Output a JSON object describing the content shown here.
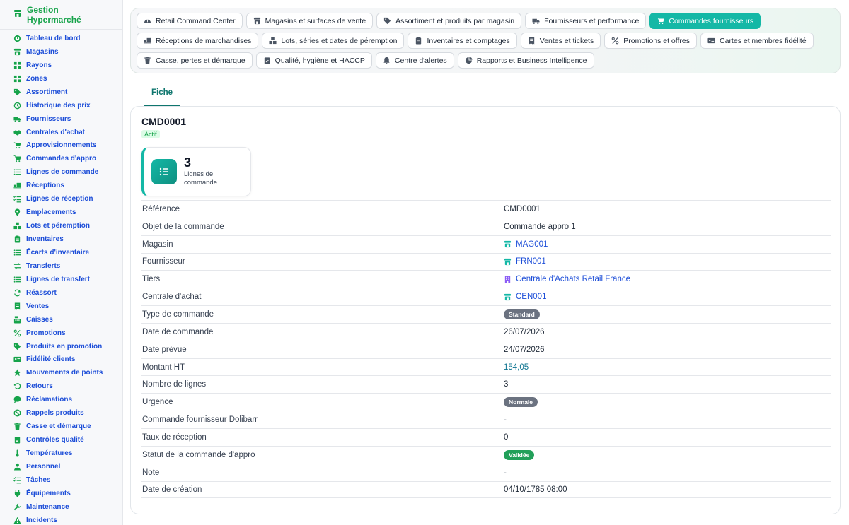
{
  "app_title": "Gestion Hypermarché",
  "colors": {
    "accent": "#14b8a6",
    "link": "#1d4ed8",
    "brand": "#16a34a"
  },
  "sidebar": {
    "items": [
      {
        "label": "Tableau de bord",
        "icon": "dashboard-icon"
      },
      {
        "label": "Magasins",
        "icon": "store-icon"
      },
      {
        "label": "Rayons",
        "icon": "grid-icon"
      },
      {
        "label": "Zones",
        "icon": "grid-icon"
      },
      {
        "label": "Assortiment",
        "icon": "tags-icon"
      },
      {
        "label": "Historique des prix",
        "icon": "history-icon"
      },
      {
        "label": "Fournisseurs",
        "icon": "truck-icon"
      },
      {
        "label": "Centrales d'achat",
        "icon": "handshake-icon"
      },
      {
        "label": "Approvisionnements",
        "icon": "cart-arrow-icon"
      },
      {
        "label": "Commandes d'appro",
        "icon": "cart-icon"
      },
      {
        "label": "Lignes de commande",
        "icon": "list-icon"
      },
      {
        "label": "Réceptions",
        "icon": "truck-loading-icon"
      },
      {
        "label": "Lignes de réception",
        "icon": "list-check-icon"
      },
      {
        "label": "Emplacements",
        "icon": "location-pin-icon"
      },
      {
        "label": "Lots et péremption",
        "icon": "boxes-icon"
      },
      {
        "label": "Inventaires",
        "icon": "clipboard-icon"
      },
      {
        "label": "Écarts d'inventaire",
        "icon": "list-icon"
      },
      {
        "label": "Transferts",
        "icon": "transfer-icon"
      },
      {
        "label": "Lignes de transfert",
        "icon": "list-icon"
      },
      {
        "label": "Réassort",
        "icon": "sync-icon"
      },
      {
        "label": "Ventes",
        "icon": "receipt-icon"
      },
      {
        "label": "Caisses",
        "icon": "cash-register-icon"
      },
      {
        "label": "Promotions",
        "icon": "percent-icon"
      },
      {
        "label": "Produits en promotion",
        "icon": "tag-icon"
      },
      {
        "label": "Fidélité clients",
        "icon": "id-card-icon"
      },
      {
        "label": "Mouvements de points",
        "icon": "star-icon"
      },
      {
        "label": "Retours",
        "icon": "undo-icon"
      },
      {
        "label": "Réclamations",
        "icon": "comment-icon"
      },
      {
        "label": "Rappels produits",
        "icon": "ban-icon"
      },
      {
        "label": "Casse et démarque",
        "icon": "trash-icon"
      },
      {
        "label": "Contrôles qualité",
        "icon": "clipboard-check-icon"
      },
      {
        "label": "Températures",
        "icon": "thermometer-icon"
      },
      {
        "label": "Personnel",
        "icon": "user-icon"
      },
      {
        "label": "Tâches",
        "icon": "tasks-icon"
      },
      {
        "label": "Équipements",
        "icon": "plug-icon"
      },
      {
        "label": "Maintenance",
        "icon": "wrench-icon"
      },
      {
        "label": "Incidents",
        "icon": "warning-icon"
      }
    ]
  },
  "modules": [
    {
      "label": "Retail Command Center",
      "icon": "gauge-icon",
      "active": false
    },
    {
      "label": "Magasins et surfaces de vente",
      "icon": "store-icon",
      "active": false
    },
    {
      "label": "Assortiment et produits par magasin",
      "icon": "tags-icon",
      "active": false
    },
    {
      "label": "Fournisseurs et performance",
      "icon": "truck-icon",
      "active": false
    },
    {
      "label": "Commandes fournisseurs",
      "icon": "cart-icon",
      "active": true
    },
    {
      "label": "Réceptions de marchandises",
      "icon": "truck-loading-icon",
      "active": false
    },
    {
      "label": "Lots, séries et dates de péremption",
      "icon": "boxes-icon",
      "active": false
    },
    {
      "label": "Inventaires et comptages",
      "icon": "clipboard-icon",
      "active": false
    },
    {
      "label": "Ventes et tickets",
      "icon": "receipt-icon",
      "active": false
    },
    {
      "label": "Promotions et offres",
      "icon": "percent-icon",
      "active": false
    },
    {
      "label": "Cartes et membres fidélité",
      "icon": "id-card-icon",
      "active": false
    },
    {
      "label": "Casse, pertes et démarque",
      "icon": "trash-icon",
      "active": false
    },
    {
      "label": "Qualité, hygiène et HACCP",
      "icon": "clipboard-check-icon",
      "active": false
    },
    {
      "label": "Centre d'alertes",
      "icon": "bell-icon",
      "active": false
    },
    {
      "label": "Rapports et Business Intelligence",
      "icon": "chart-pie-icon",
      "active": false
    }
  ],
  "tabs": [
    {
      "label": "Fiche"
    }
  ],
  "record": {
    "title": "CMD0001",
    "status": "Actif",
    "stat": {
      "value": "3",
      "label": "Lignes de commande",
      "icon": "list-icon"
    },
    "fields": [
      {
        "label": "Référence",
        "value": "CMD0001",
        "kind": "text"
      },
      {
        "label": "Objet de la commande",
        "value": "Commande appro 1",
        "kind": "text"
      },
      {
        "label": "Magasin",
        "value": "MAG001",
        "kind": "link",
        "icon": "store-icon"
      },
      {
        "label": "Fournisseur",
        "value": "FRN001",
        "kind": "link",
        "icon": "store-icon"
      },
      {
        "label": "Tiers",
        "value": "Centrale d'Achats Retail France",
        "kind": "link",
        "icon": "building-icon"
      },
      {
        "label": "Centrale d'achat",
        "value": "CEN001",
        "kind": "link",
        "icon": "store-icon"
      },
      {
        "label": "Type de commande",
        "value": "Standard",
        "kind": "badge",
        "color": "grey"
      },
      {
        "label": "Date de commande",
        "value": "26/07/2026",
        "kind": "text"
      },
      {
        "label": "Date prévue",
        "value": "24/07/2026",
        "kind": "text"
      },
      {
        "label": "Montant HT",
        "value": "154,05",
        "kind": "amount"
      },
      {
        "label": "Nombre de lignes",
        "value": "3",
        "kind": "text"
      },
      {
        "label": "Urgence",
        "value": "Normale",
        "kind": "badge",
        "color": "grey"
      },
      {
        "label": "Commande fournisseur Dolibarr",
        "value": "-",
        "kind": "muted"
      },
      {
        "label": "Taux de réception",
        "value": "0",
        "kind": "text"
      },
      {
        "label": "Statut de la commande d'appro",
        "value": "Validée",
        "kind": "badge",
        "color": "green"
      },
      {
        "label": "Note",
        "value": "-",
        "kind": "muted"
      },
      {
        "label": "Date de création",
        "value": "04/10/1785 08:00",
        "kind": "text"
      }
    ]
  }
}
